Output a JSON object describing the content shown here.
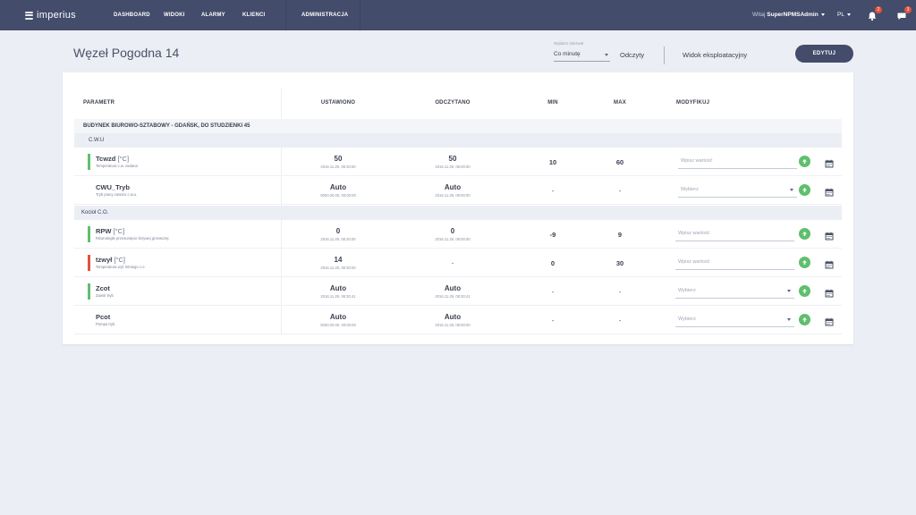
{
  "app": {
    "logo_text": "imperius",
    "nav": [
      "DASHBOARD",
      "WIDOKI",
      "ALARMY",
      "KLIENCI",
      "ADMINISTRACJA"
    ],
    "greeting": "Witaj",
    "username": "SuperNPMSAdmin",
    "language": "PL",
    "notifications_count": "2",
    "messages_count": "3"
  },
  "header": {
    "title": "Węzeł Pogodna 14",
    "interval_label": "Wybierz interwał",
    "interval_value": "Co minutę",
    "readings_link": "Odczyty",
    "operational_view_link": "Widok eksploatacyjny",
    "edit_button": "EDYTUJ"
  },
  "table": {
    "columns": {
      "param": "PARAMETR",
      "set": "USTAWIONO",
      "read": "ODCZYTANO",
      "min": "MIN",
      "max": "MAX",
      "modify": "MODYFIKUJ"
    },
    "building": "BUDYNEK BIUROWO-SZTABOWY - GDAŃSK, DO STUDZIENKI 45",
    "groups": [
      {
        "name": "C.W.U",
        "rows": [
          {
            "flag_color": "#5fbf6e",
            "name": "Tcwzd",
            "unit": "[°C]",
            "desc": "Temperatura c.w. zadana",
            "set_value": "50",
            "set_ts": "2016.11.29, 08:30:00",
            "read_value": "50",
            "read_ts": "2016.11.29, 08:00:00",
            "min": "10",
            "max": "60",
            "input_placeholder": "Wpisz wartość",
            "input_type": "text"
          },
          {
            "flag_color": "",
            "name": "CWU_Tryb",
            "unit": "",
            "desc": "Tryb pracy zaworu c.w.u.",
            "set_value": "Auto",
            "set_ts": "0000.00.00, 00:00:00",
            "read_value": "Auto",
            "read_ts": "2016.11.29, 08:00:00",
            "min": "-",
            "max": "-",
            "input_placeholder": "Wybierz",
            "input_type": "select"
          }
        ]
      },
      {
        "name": "Kocioł C.O.",
        "rows": [
          {
            "flag_color": "#5fbf6e",
            "name": "RPW",
            "unit": "[°C]",
            "desc": "Równoległe przesunięcie krzywej grzewczej",
            "set_value": "0",
            "set_ts": "2016.11.29, 08:30:00",
            "read_value": "0",
            "read_ts": "2016.11.29, 08:00:00",
            "min": "-9",
            "max": "9",
            "input_placeholder": "Wpisz wartość",
            "input_type": "text"
          },
          {
            "flag_color": "#e0533f",
            "name": "tzwył",
            "unit": "[°C]",
            "desc": "Temperatura wył. letniego c.o.",
            "set_value": "14",
            "set_ts": "2016.11.29, 08:30:00",
            "read_value": "-",
            "read_ts": "",
            "min": "0",
            "max": "30",
            "input_placeholder": "Wpisz wartość",
            "input_type": "text"
          },
          {
            "flag_color": "#5fbf6e",
            "name": "Zcot",
            "unit": "",
            "desc": "Zawór tryb",
            "set_value": "Auto",
            "set_ts": "2016.11.29, 08:30:41",
            "read_value": "Auto",
            "read_ts": "2016.11.29, 08:30:41",
            "min": "-",
            "max": "-",
            "input_placeholder": "Wybierz",
            "input_type": "select"
          },
          {
            "flag_color": "",
            "name": "Pcot",
            "unit": "",
            "desc": "Pompa tryb",
            "set_value": "Auto",
            "set_ts": "0000.00.00, 00:00:00",
            "read_value": "Auto",
            "read_ts": "2016.11.29, 08:00:00",
            "min": "-",
            "max": "-",
            "input_placeholder": "Wybierz",
            "input_type": "select"
          }
        ]
      }
    ]
  }
}
